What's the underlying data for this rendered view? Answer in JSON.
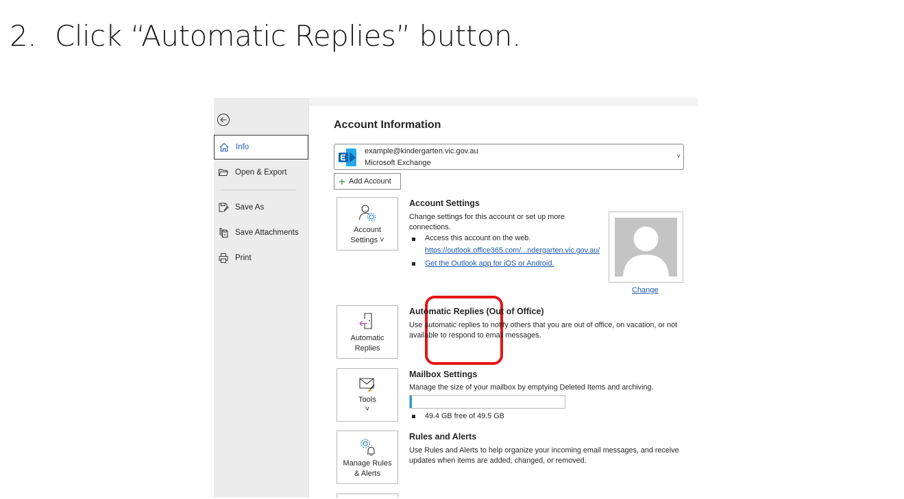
{
  "instruction": {
    "number": "2.",
    "text": "Click “Automatic Replies” button."
  },
  "nav": {
    "items": [
      {
        "label": "Info",
        "icon": "home-icon",
        "active": true
      },
      {
        "label": "Open & Export",
        "icon": "folder-open-icon"
      },
      {
        "label": "Save As",
        "icon": "save-as-icon"
      },
      {
        "label": "Save Attachments",
        "icon": "save-attachments-icon"
      },
      {
        "label": "Print",
        "icon": "printer-icon"
      }
    ]
  },
  "account": {
    "title": "Account Information",
    "email": "example@kindergarten.vic.gov.au",
    "type": "Microsoft Exchange",
    "add_label": "Add Account"
  },
  "account_settings": {
    "tile_line1": "Account",
    "tile_line2": "Settings ˅",
    "title": "Account Settings",
    "desc": "Change settings for this account or set up more connections.",
    "bullet1": "Access this account on the web.",
    "link1": "https://outlook.office365.com/...ndergarten.vic.gov.au/",
    "link2": "Get the Outlook app for iOS or Android.",
    "change_label": "Change"
  },
  "auto_replies": {
    "tile_line1": "Automatic",
    "tile_line2": "Replies",
    "title": "Automatic Replies (Out of Office)",
    "desc": "Use automatic replies to notify others that you are out of office, on vacation, or not available to respond to email messages."
  },
  "mailbox": {
    "tile_line1": "Tools",
    "tile_line2": "˅",
    "title": "Mailbox Settings",
    "desc": "Manage the size of your mailbox by emptying Deleted Items and archiving.",
    "usage_fraction": 0.01,
    "free_text": "49.4 GB free of 49.5 GB"
  },
  "rules": {
    "tile_line1": "Manage Rules",
    "tile_line2": "& Alerts",
    "title": "Rules and Alerts",
    "desc": "Use Rules and Alerts to help organize your incoming email messages, and receive updates when items are added, changed, or removed."
  },
  "colors": {
    "accent": "#1a58b0",
    "highlight": "#e31515",
    "exchange_blue": "#0a64ad",
    "progress": "#2b9ccd"
  }
}
